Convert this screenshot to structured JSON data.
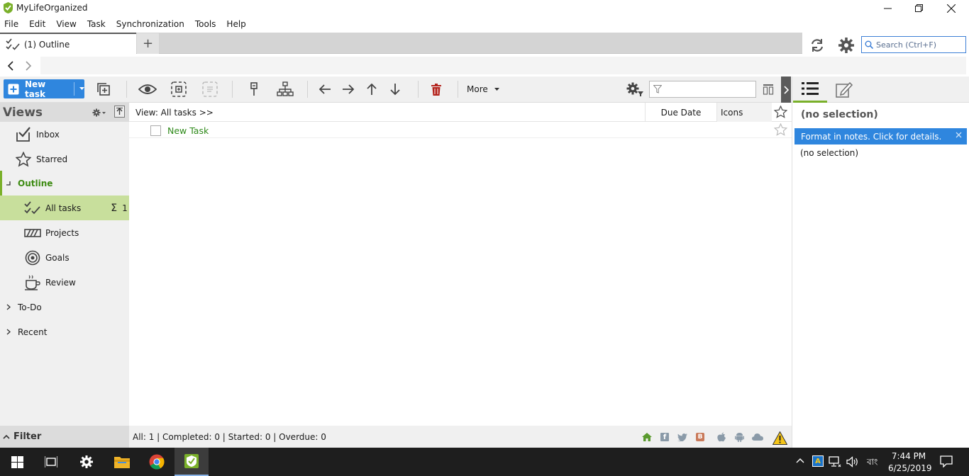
{
  "window": {
    "title": "MyLifeOrganized"
  },
  "menu": [
    "File",
    "Edit",
    "View",
    "Task",
    "Synchronization",
    "Tools",
    "Help"
  ],
  "tabs": {
    "active_label": "(1) Outline",
    "add_label": "+"
  },
  "search": {
    "placeholder": "Search (Ctrl+F)"
  },
  "toolbar": {
    "new_task_label": "New task",
    "more_label": "More"
  },
  "views": {
    "title": "Views",
    "items": [
      {
        "label": "Inbox",
        "icon": "inbox-icon"
      },
      {
        "label": "Starred",
        "icon": "star-icon"
      },
      {
        "label": "Outline",
        "icon": "expanded-indicator"
      },
      {
        "label": "All tasks",
        "icon": "checklist-icon",
        "count_symbol": "Σ",
        "count": "1"
      },
      {
        "label": "Projects",
        "icon": "projects-icon"
      },
      {
        "label": "Goals",
        "icon": "target-icon"
      },
      {
        "label": "Review",
        "icon": "coffee-cup-icon"
      },
      {
        "label": "To-Do",
        "icon": "chevron-right-icon"
      },
      {
        "label": "Recent",
        "icon": "chevron-right-icon"
      }
    ]
  },
  "grid": {
    "view_label": "View: All tasks >>",
    "columns": [
      "Due Date",
      "Icons"
    ],
    "rows": [
      {
        "title": "New Task",
        "completed": false
      }
    ]
  },
  "right_panel": {
    "selection_title": "(no selection)",
    "info_banner": "Format in notes. Click  for details.",
    "notes": "(no selection)"
  },
  "filter": {
    "label": "Filter"
  },
  "status": {
    "text": "All: 1 | Completed: 0 | Started: 0 | Overdue: 0"
  },
  "taskbar": {
    "time": "7:44 PM",
    "date": "6/25/2019",
    "language": "বাং"
  },
  "colors": {
    "accent_blue": "#2f86de",
    "selection_green": "#c8df9c",
    "outline_green": "#3d8b12",
    "task_green": "#2f8a1a"
  }
}
